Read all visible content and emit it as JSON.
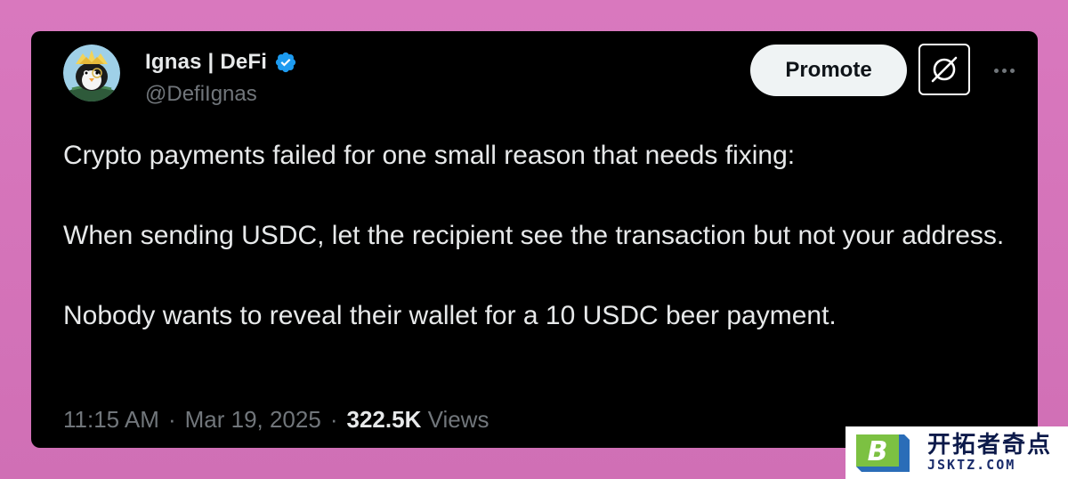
{
  "author": {
    "display_name": "Ignas | DeFi",
    "handle": "@DefiIgnas",
    "verified": true,
    "verified_icon": "verified-badge-icon",
    "avatar_icon": "penguin-avatar"
  },
  "actions": {
    "promote_label": "Promote",
    "grok_icon": "grok-icon",
    "more_icon": "more-horizontal-icon"
  },
  "tweet": {
    "paragraphs": [
      "Crypto payments failed for one small reason that needs fixing:",
      "When sending USDC, let the recipient see the transaction but not your address.",
      "Nobody wants to reveal their wallet for a 10 USDC beer payment."
    ]
  },
  "meta": {
    "time": "11:15 AM",
    "separator": "·",
    "date": "Mar 19, 2025",
    "views_count": "322.5K",
    "views_label": "Views"
  },
  "watermark": {
    "title": "开拓者奇点",
    "url": "JSKTZ.COM",
    "logo_letter": "B"
  },
  "colors": {
    "background": "#d978be",
    "card": "#000000",
    "text_primary": "#e7e9ea",
    "text_secondary": "#71767b",
    "verified_blue": "#1d9bf0",
    "promote_bg": "#eff3f4"
  }
}
